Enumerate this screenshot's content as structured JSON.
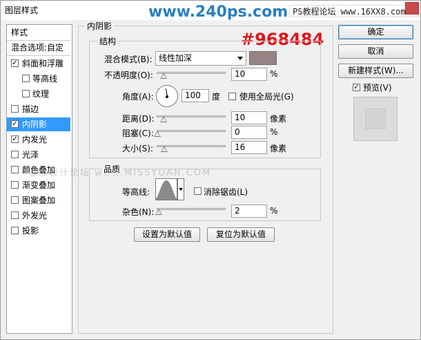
{
  "window": {
    "title": "图层样式"
  },
  "watermarks": {
    "site_main": "www.240ps.com",
    "site_secondary": "PS教程论坛 www.16XX8.com",
    "faint": "思缘设计论坛 www.MISSYUAN.COM",
    "color_code": "#968484"
  },
  "styles_list": {
    "header": "样式",
    "blend_options": "混合选项:自定",
    "items": [
      {
        "label": "斜面和浮雕",
        "checked": "✓",
        "indent": false,
        "selected": false
      },
      {
        "label": "等高线",
        "checked": "",
        "indent": true,
        "selected": false
      },
      {
        "label": "纹理",
        "checked": "",
        "indent": true,
        "selected": false
      },
      {
        "label": "描边",
        "checked": "",
        "indent": false,
        "selected": false
      },
      {
        "label": "内阴影",
        "checked": "✓",
        "indent": false,
        "selected": true
      },
      {
        "label": "内发光",
        "checked": "✓",
        "indent": false,
        "selected": false
      },
      {
        "label": "光泽",
        "checked": "",
        "indent": false,
        "selected": false
      },
      {
        "label": "颜色叠加",
        "checked": "",
        "indent": false,
        "selected": false
      },
      {
        "label": "渐变叠加",
        "checked": "",
        "indent": false,
        "selected": false
      },
      {
        "label": "图案叠加",
        "checked": "",
        "indent": false,
        "selected": false
      },
      {
        "label": "外发光",
        "checked": "",
        "indent": false,
        "selected": false
      },
      {
        "label": "投影",
        "checked": "",
        "indent": false,
        "selected": false
      }
    ]
  },
  "inner_shadow": {
    "title": "内阴影",
    "structure": {
      "title": "结构",
      "blend_mode_label": "混合模式(B):",
      "blend_mode_value": "线性加深",
      "color": "#968484",
      "opacity_label": "不透明度(O):",
      "opacity_value": "10",
      "opacity_unit": "%",
      "opacity_fraction": 0.1,
      "angle_label": "角度(A):",
      "angle_value": "100",
      "angle_unit": "度",
      "global_light_label": "使用全局光(G)",
      "global_light_checked": "",
      "distance_label": "距离(D):",
      "distance_value": "10",
      "distance_unit": "像素",
      "choke_label": "阻塞(C):",
      "choke_value": "0",
      "choke_unit": "%",
      "size_label": "大小(S):",
      "size_value": "16",
      "size_unit": "像素"
    },
    "quality": {
      "title": "品质",
      "contour_label": "等高线:",
      "anti_alias_label": "消除锯齿(L)",
      "anti_alias_checked": "",
      "noise_label": "杂色(N):",
      "noise_value": "2",
      "noise_unit": "%"
    },
    "set_default_button": "设置为默认值",
    "reset_default_button": "复位为默认值"
  },
  "right_buttons": {
    "ok": "确定",
    "cancel": "取消",
    "new_style": "新建样式(W)...",
    "preview_label": "预览(V)",
    "preview_checked": "✓"
  }
}
